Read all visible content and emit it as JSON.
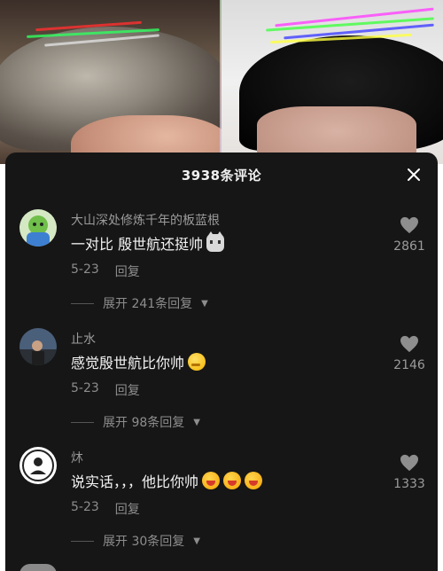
{
  "panel": {
    "title": "3938条评论"
  },
  "comments": [
    {
      "username": "大山深处修炼千年的板蓝根",
      "text": "一对比 殷世航还挺帅",
      "emoji": "cat-face-emoji",
      "date": "5-23",
      "reply_label": "回复",
      "expand_label": "展开 241条回复",
      "likes": "2861"
    },
    {
      "username": "止水",
      "text": "感觉殷世航比你帅",
      "emoji": "thinking-face-emoji",
      "date": "5-23",
      "reply_label": "回复",
      "expand_label": "展开 98条回复",
      "likes": "2146"
    },
    {
      "username": "炑",
      "text": "说实话，，，他比你帅",
      "emoji": "laughing-face-emoji",
      "date": "5-23",
      "reply_label": "回复",
      "expand_label": "展开 30条回复",
      "likes": "1333"
    }
  ],
  "colors": {
    "panel_bg": "#161616",
    "text_primary": "#f4f4f4",
    "text_secondary": "#8d8d8d"
  }
}
